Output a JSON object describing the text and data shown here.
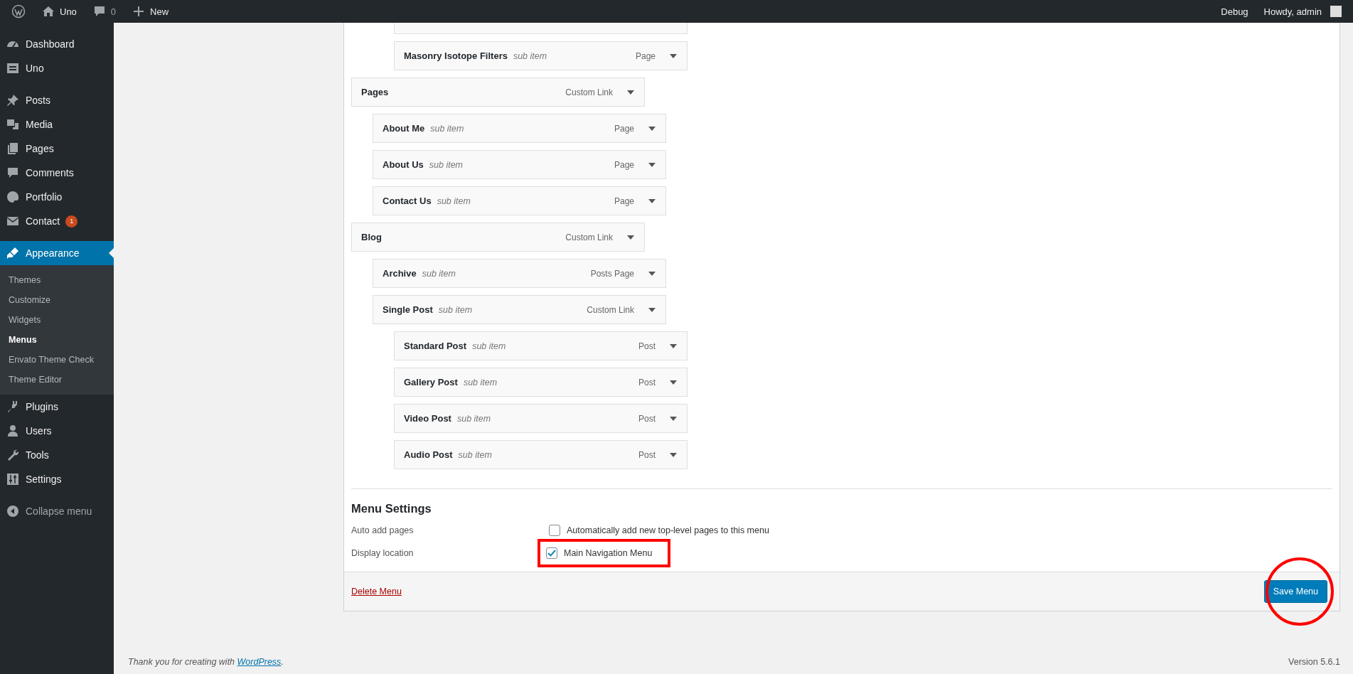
{
  "admin_bar": {
    "site": "Uno",
    "comments": "0",
    "new_label": "New",
    "right": [
      "Debug",
      "Howdy, admin"
    ]
  },
  "sidebar": {
    "sections": [
      [
        {
          "label": "Dashboard",
          "selected": false
        },
        {
          "label": "Uno",
          "selected": false
        }
      ],
      [
        {
          "label": "Posts",
          "selected": false
        },
        {
          "label": "Media",
          "selected": false
        },
        {
          "label": "Pages",
          "selected": false
        },
        {
          "label": "Comments",
          "selected": false
        },
        {
          "label": "Portfolio",
          "selected": false
        },
        {
          "label": "Contact",
          "selected": false,
          "badge": "1"
        }
      ],
      [
        {
          "label": "Appearance",
          "selected": true,
          "children": [
            {
              "label": "Themes",
              "selected": false
            },
            {
              "label": "Customize",
              "selected": false
            },
            {
              "label": "Widgets",
              "selected": false
            },
            {
              "label": "Menus",
              "selected": true
            },
            {
              "label": "Envato Theme Check",
              "selected": false
            },
            {
              "label": "Theme Editor",
              "selected": false
            }
          ]
        },
        {
          "label": "Plugins",
          "selected": false
        },
        {
          "label": "Users",
          "selected": false
        },
        {
          "label": "Tools",
          "selected": false
        },
        {
          "label": "Settings",
          "selected": false
        }
      ]
    ],
    "collapse": "Collapse menu"
  },
  "menu_items": [
    {
      "kind": "offscreen",
      "children": [
        {
          "kind": "offscreen",
          "children": [
            {
              "kind": "clipped"
            },
            {
              "kind": "item",
              "title": "Masonry Isotope Filters",
              "note": "sub item",
              "type": "Page"
            }
          ]
        }
      ]
    },
    {
      "kind": "item",
      "title": "Pages",
      "type": "Custom Link",
      "children": [
        {
          "kind": "item",
          "title": "About Me",
          "note": "sub item",
          "type": "Page"
        },
        {
          "kind": "item",
          "title": "About Us",
          "note": "sub item",
          "type": "Page"
        },
        {
          "kind": "item",
          "title": "Contact Us",
          "note": "sub item",
          "type": "Page"
        }
      ]
    },
    {
      "kind": "item",
      "title": "Blog",
      "type": "Custom Link",
      "children": [
        {
          "kind": "item",
          "title": "Archive",
          "note": "sub item",
          "type": "Posts Page"
        },
        {
          "kind": "item",
          "title": "Single Post",
          "note": "sub item",
          "type": "Custom Link",
          "children": [
            {
              "kind": "item",
              "title": "Standard Post",
              "note": "sub item",
              "type": "Post"
            },
            {
              "kind": "item",
              "title": "Gallery Post",
              "note": "sub item",
              "type": "Post"
            },
            {
              "kind": "item",
              "title": "Video Post",
              "note": "sub item",
              "type": "Post"
            },
            {
              "kind": "item",
              "title": "Audio Post",
              "note": "sub item",
              "type": "Post"
            }
          ]
        }
      ]
    }
  ],
  "menu_settings": {
    "title": "Menu Settings",
    "rows": [
      {
        "label": "Auto add pages",
        "option": "Automatically add new top-level pages to this menu",
        "checked": false,
        "highlighted": false
      },
      {
        "label": "Display location",
        "option": "Main Navigation Menu",
        "checked": true,
        "highlighted": true
      }
    ]
  },
  "actions": {
    "delete": "Delete Menu",
    "save": "Save Menu",
    "save_circled": true
  },
  "footer": {
    "text": "Thank you for creating with ",
    "link": "WordPress",
    "after": ".",
    "version": "Version 5.6.1"
  }
}
